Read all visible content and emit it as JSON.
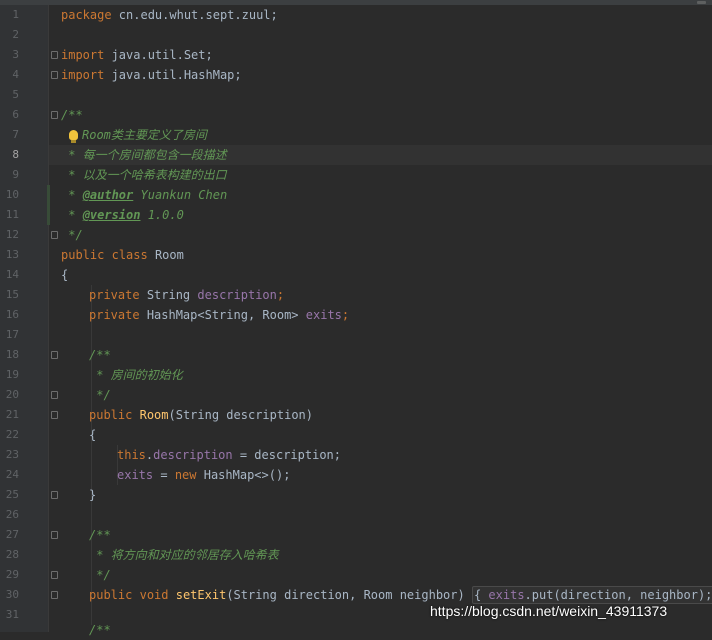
{
  "editor": {
    "language": "java",
    "active_line": 8,
    "line_numbers": [
      "1",
      "2",
      "3",
      "4",
      "5",
      "6",
      "7",
      "8",
      "9",
      "10",
      "11",
      "12",
      "13",
      "14",
      "15",
      "16",
      "17",
      "18",
      "19",
      "20",
      "21",
      "22",
      "23",
      "24",
      "25",
      "26",
      "27",
      "28",
      "29",
      "30",
      "31"
    ],
    "lines": {
      "l1": {
        "kw": "package",
        "rest": " cn.edu.whut.sept.zuul;"
      },
      "l3": {
        "kw": "import",
        "rest": " java.util.Set;"
      },
      "l4": {
        "kw": "import",
        "rest": " java.util.HashMap;"
      },
      "l6": {
        "cm": "/**"
      },
      "l7": {
        "cm": "Room类主要定义了房间"
      },
      "l8": {
        "cm": " * 每一个房间都包含一段描述"
      },
      "l9": {
        "cm": " * 以及一个哈希表构建的出口"
      },
      "l10": {
        "pre": " * ",
        "tag": "@author",
        "post": " Yuankun Chen"
      },
      "l11": {
        "pre": " * ",
        "tag": "@version",
        "post": " 1.0.0"
      },
      "l12": {
        "cm": " */"
      },
      "l13": {
        "kw1": "public",
        "kw2": "class",
        "name": "Room"
      },
      "l14": {
        "text": "{"
      },
      "l15": {
        "kw": "private",
        "type": "String",
        "field": "description",
        "end": ";"
      },
      "l16": {
        "kw": "private",
        "type": "HashMap<String, Room>",
        "field": "exits",
        "end": ";"
      },
      "l18": {
        "cm": "/**"
      },
      "l19": {
        "cm": " * 房间的初始化"
      },
      "l20": {
        "cm": " */"
      },
      "l21": {
        "kw": "public",
        "fn": "Room",
        "args": "(String description)"
      },
      "l22": {
        "text": "{"
      },
      "l23": {
        "kw": "this",
        "dot": ".",
        "field": "description",
        "rest": " = description;"
      },
      "l24": {
        "field": "exits",
        "op": " = ",
        "kw": "new",
        "rest": " HashMap<>();"
      },
      "l25": {
        "text": "}"
      },
      "l27": {
        "cm": "/**"
      },
      "l28": {
        "cm": " * 将方向和对应的邻居存入哈希表"
      },
      "l29": {
        "cm": " */"
      },
      "l30": {
        "kw1": "public",
        "kw2": "void",
        "fn": "setExit",
        "args": "(String direction, Room neighbor)",
        "body_open": "{ ",
        "field": "exits",
        "rest": ".put(direction, neighbor); }"
      }
    }
  },
  "watermark": "https://blog.csdn.net/weixin_43911373",
  "colors": {
    "background": "#2b2b2b",
    "gutter": "#313335",
    "keyword": "#cc7832",
    "field": "#9876aa",
    "method": "#ffc66d",
    "comment": "#629755",
    "text": "#a9b7c6"
  }
}
